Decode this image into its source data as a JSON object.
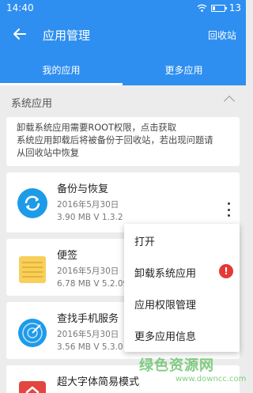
{
  "status_bar": {
    "time": "14:40",
    "battery": "13"
  },
  "app_bar": {
    "title": "应用管理",
    "recycle_label": "回收站"
  },
  "tabs": [
    {
      "label": "我的应用"
    },
    {
      "label": "更多应用"
    }
  ],
  "section": {
    "label": "系统应用"
  },
  "notice": {
    "line1": "卸载系统应用需要ROOT权限，点击获取",
    "line2": "系统应用卸载后将被备份于回收站，若出现问题请",
    "line3": "从回收站中恢复"
  },
  "apps": [
    {
      "name": "备份与恢复",
      "date": "2016年5月30日",
      "meta": "3.90 MB  V 1.3.2"
    },
    {
      "name": "便签",
      "date": "2016年5月30日",
      "meta": "6.78 MB  V 5.2.090"
    },
    {
      "name": "查找手机服务",
      "date": "2016年5月30日",
      "meta": "3.56 MB  V 5.3.0"
    },
    {
      "name": "超大字体简易模式"
    }
  ],
  "menu": {
    "items": [
      {
        "label": "打开"
      },
      {
        "label": "卸载系统应用"
      },
      {
        "label": "应用权限管理"
      },
      {
        "label": "更多应用信息"
      }
    ],
    "warning_mark": "!"
  },
  "watermark": {
    "text": "绿色资源网",
    "url": "www.downcc.com"
  },
  "colors": {
    "primary": "#2e8ff0",
    "warning": "#e53935"
  }
}
